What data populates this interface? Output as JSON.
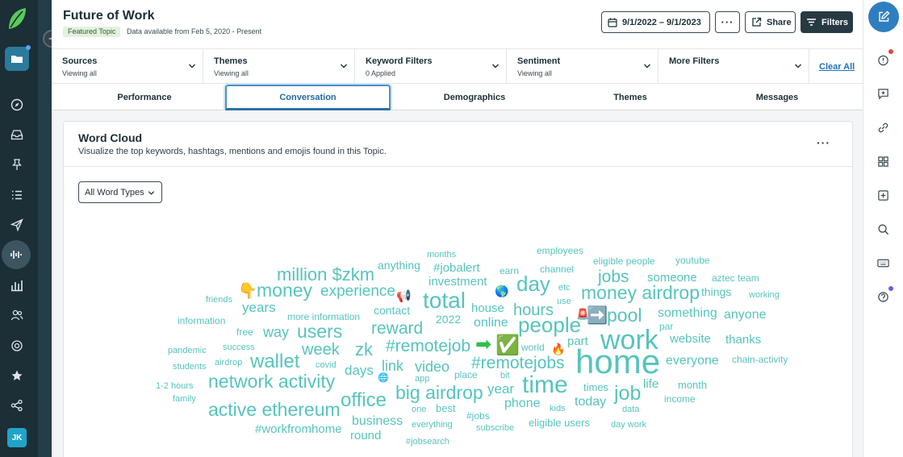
{
  "header": {
    "title": "Future of Work",
    "badge": "Featured Topic",
    "data_available": "Data available from Feb 5, 2020 - Present",
    "date_range": "9/1/2022 – 9/1/2023",
    "more_label": "···",
    "share_label": "Share",
    "filters_label": "Filters"
  },
  "filters": [
    {
      "label": "Sources",
      "sub": "Viewing all"
    },
    {
      "label": "Themes",
      "sub": "Viewing all"
    },
    {
      "label": "Keyword Filters",
      "sub": "0 Applied"
    },
    {
      "label": "Sentiment",
      "sub": "Viewing all"
    },
    {
      "label": "More Filters",
      "sub": ""
    }
  ],
  "clear_all": "Clear All",
  "tabs": [
    "Performance",
    "Conversation",
    "Demographics",
    "Themes",
    "Messages"
  ],
  "active_tab": "Conversation",
  "card": {
    "title": "Word Cloud",
    "subtitle": "Visualize the top keywords, hashtags, mentions and emojis found in this Topic.",
    "menu": "···",
    "word_type_select": "All Word Types"
  },
  "user_initials": "JK",
  "colors": {
    "word": "#56c4bd",
    "accent": "#2e7ec0",
    "rail": "#1c2e36"
  },
  "icons": {
    "left_rail": [
      "folder-icon",
      "compass-icon",
      "inbox-icon",
      "pin-icon",
      "list-icon",
      "send-icon",
      "listening-bars-icon",
      "bar-chart-icon",
      "people-icon",
      "support-icon",
      "star-badge-icon",
      "network-icon"
    ],
    "right_rail": [
      "compose-icon",
      "alert-icon",
      "add-message-icon",
      "link-icon",
      "grid-icon",
      "add-box-icon",
      "search-icon",
      "keyboard-icon",
      "help-icon"
    ]
  },
  "emojis": {
    "point_down": "👇",
    "megaphone": "📢",
    "globe_americas": "🌎",
    "siren": "🚨",
    "arrow_box": "➡️",
    "arrow": "➡",
    "check_box": "✅",
    "fire": "🔥",
    "globe_meridians": "🌐"
  },
  "words": {
    "months": "months",
    "employees": "employees",
    "anything": "anything",
    "jobalert": "#jobalert",
    "earn": "earn",
    "channel": "channel",
    "eligible_people": "eligible people",
    "youtube": "youtube",
    "million_zkm": "million $zkm",
    "investment": "investment",
    "day": "day",
    "jobs": "jobs",
    "someone": "someone",
    "aztec_team": "aztec team",
    "money": "money",
    "experience": "experience",
    "etc": "etc",
    "money_airdrop": "money airdrop",
    "things": "things",
    "friends": "friends",
    "total": "total",
    "use": "use",
    "working": "working",
    "years": "years",
    "house": "house",
    "hours": "hours",
    "contact": "contact",
    "pool": "pool",
    "something": "something",
    "anyone": "anyone",
    "information": "information",
    "more_information": "more information",
    "y2022": "2022",
    "online": "online",
    "people": "people",
    "reward": "reward",
    "par": "par",
    "free": "free",
    "way": "way",
    "users": "users",
    "work": "work",
    "website": "website",
    "thanks": "thanks",
    "part": "part",
    "pandemic": "pandemic",
    "success": "success",
    "week": "week",
    "zk": "zk",
    "remotejob": "#remotejob",
    "world": "world",
    "everyone": "everyone",
    "chain_activity": "chain-activity",
    "airdrop": "airdrop",
    "wallet": "wallet",
    "covid": "covid",
    "link": "link",
    "remotejobs": "#remotejobs",
    "home": "home",
    "students": "students",
    "days": "days",
    "video": "video",
    "place": "place",
    "bit": "bit",
    "network_activity": "network activity",
    "app": "app",
    "time": "time",
    "life": "life",
    "month": "month",
    "one_two_hours": "1-2 hours",
    "year": "year",
    "times": "times",
    "job": "job",
    "family": "family",
    "big_airdrop": "big airdrop",
    "office": "office",
    "income": "income",
    "today": "today",
    "phone": "phone",
    "active_ethereum": "active ethereum",
    "one": "one",
    "best": "best",
    "kids": "kids",
    "data": "data",
    "jobs_tag": "#jobs",
    "business": "business",
    "eligible_users": "eligible users",
    "workfromhome": "#workfromhome",
    "everything": "everything",
    "subscribe": "subscribe",
    "day_work": "day work",
    "round": "round",
    "jobsearch": "#jobsearch"
  }
}
